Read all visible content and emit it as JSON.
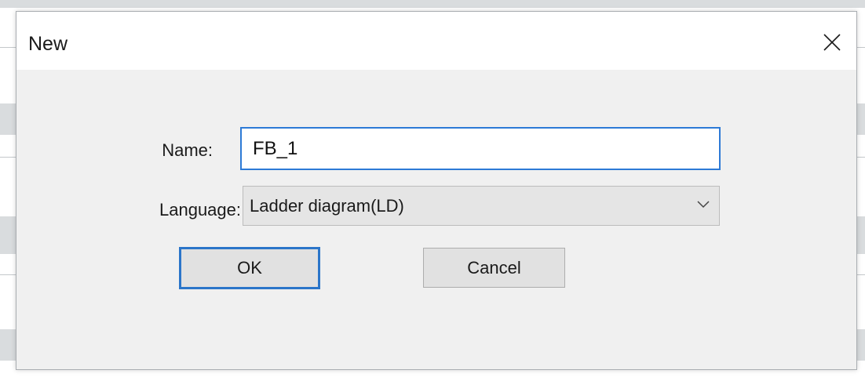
{
  "window": {
    "title": "New",
    "close_icon": "close-icon"
  },
  "form": {
    "name_label": "Name:",
    "name_value": "FB_1",
    "language_label": "Language:",
    "language_value": "Ladder diagram(LD)",
    "dropdown_icon": "chevron-down-icon"
  },
  "buttons": {
    "ok_label": "OK",
    "cancel_label": "Cancel"
  },
  "colors": {
    "accent": "#2d7ad6",
    "dialog_bg": "#f0f0f0",
    "titlebar_bg": "#ffffff"
  }
}
